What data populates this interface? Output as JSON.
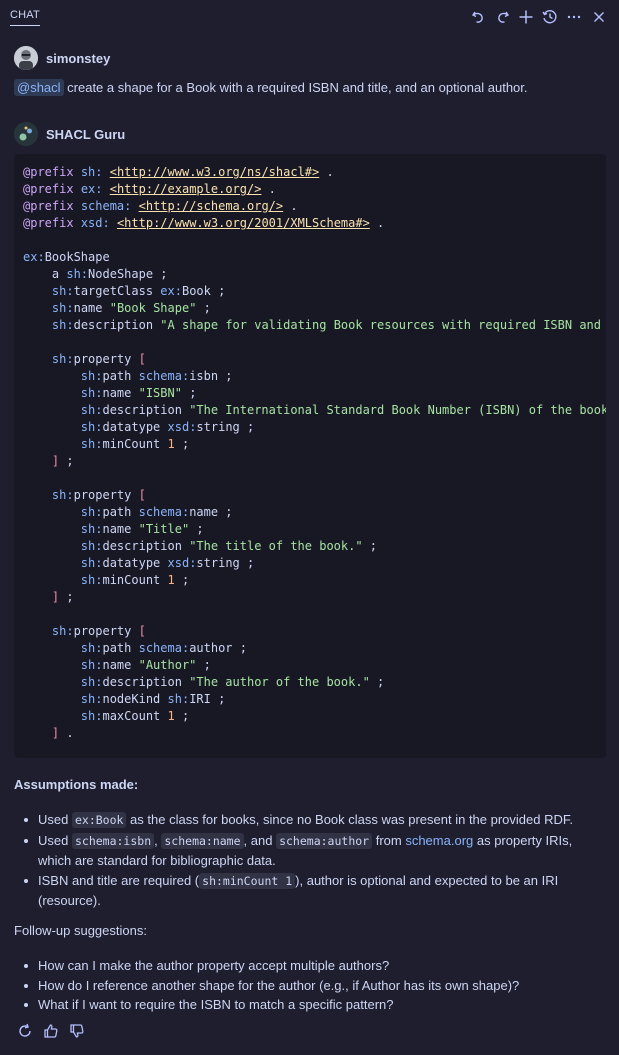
{
  "header": {
    "tab_label": "CHAT"
  },
  "user_message": {
    "username": "simonstey",
    "mention": "@shacl",
    "text": " create a shape for a Book with a required ISBN and title, and an optional author."
  },
  "bot_message": {
    "name": "SHACL Guru",
    "code_lines": [
      [
        [
          "kw",
          "@prefix"
        ],
        [
          "t",
          " "
        ],
        [
          "pfx",
          "sh:"
        ],
        [
          "t",
          " "
        ],
        [
          "iri",
          "<http://www.w3.org/ns/shacl#>"
        ],
        [
          "t",
          " ."
        ]
      ],
      [
        [
          "kw",
          "@prefix"
        ],
        [
          "t",
          " "
        ],
        [
          "pfx",
          "ex:"
        ],
        [
          "t",
          " "
        ],
        [
          "iri",
          "<http://example.org/>"
        ],
        [
          "t",
          " ."
        ]
      ],
      [
        [
          "kw",
          "@prefix"
        ],
        [
          "t",
          " "
        ],
        [
          "pfx",
          "schema:"
        ],
        [
          "t",
          " "
        ],
        [
          "iri",
          "<http://schema.org/>"
        ],
        [
          "t",
          " ."
        ]
      ],
      [
        [
          "kw",
          "@prefix"
        ],
        [
          "t",
          " "
        ],
        [
          "pfx",
          "xsd:"
        ],
        [
          "t",
          " "
        ],
        [
          "iri",
          "<http://www.w3.org/2001/XMLSchema#>"
        ],
        [
          "t",
          " ."
        ]
      ],
      [],
      [
        [
          "pfx",
          "ex:"
        ],
        [
          "t",
          "BookShape"
        ]
      ],
      [
        [
          "t",
          "    a "
        ],
        [
          "pfx",
          "sh:"
        ],
        [
          "t",
          "NodeShape ;"
        ]
      ],
      [
        [
          "t",
          "    "
        ],
        [
          "pfx",
          "sh:"
        ],
        [
          "t",
          "targetClass "
        ],
        [
          "pfx",
          "ex:"
        ],
        [
          "t",
          "Book ;"
        ]
      ],
      [
        [
          "t",
          "    "
        ],
        [
          "pfx",
          "sh:"
        ],
        [
          "t",
          "name "
        ],
        [
          "str",
          "\"Book Shape\""
        ],
        [
          "t",
          " ;"
        ]
      ],
      [
        [
          "t",
          "    "
        ],
        [
          "pfx",
          "sh:"
        ],
        [
          "t",
          "description "
        ],
        [
          "str",
          "\"A shape for validating Book resources with required ISBN and title, and an optional author.\""
        ],
        [
          "t",
          " ;"
        ]
      ],
      [],
      [
        [
          "t",
          "    "
        ],
        [
          "pfx",
          "sh:"
        ],
        [
          "t",
          "property "
        ],
        [
          "brk",
          "["
        ]
      ],
      [
        [
          "t",
          "        "
        ],
        [
          "pfx",
          "sh:"
        ],
        [
          "t",
          "path "
        ],
        [
          "pfx",
          "schema:"
        ],
        [
          "t",
          "isbn ;"
        ]
      ],
      [
        [
          "t",
          "        "
        ],
        [
          "pfx",
          "sh:"
        ],
        [
          "t",
          "name "
        ],
        [
          "str",
          "\"ISBN\""
        ],
        [
          "t",
          " ;"
        ]
      ],
      [
        [
          "t",
          "        "
        ],
        [
          "pfx",
          "sh:"
        ],
        [
          "t",
          "description "
        ],
        [
          "str",
          "\"The International Standard Book Number (ISBN) of the book.\""
        ],
        [
          "t",
          " ;"
        ]
      ],
      [
        [
          "t",
          "        "
        ],
        [
          "pfx",
          "sh:"
        ],
        [
          "t",
          "datatype "
        ],
        [
          "pfx",
          "xsd:"
        ],
        [
          "t",
          "string ;"
        ]
      ],
      [
        [
          "t",
          "        "
        ],
        [
          "pfx",
          "sh:"
        ],
        [
          "t",
          "minCount "
        ],
        [
          "num",
          "1"
        ],
        [
          "t",
          " ;"
        ]
      ],
      [
        [
          "t",
          "    "
        ],
        [
          "brk",
          "]"
        ],
        [
          "t",
          " ;"
        ]
      ],
      [],
      [
        [
          "t",
          "    "
        ],
        [
          "pfx",
          "sh:"
        ],
        [
          "t",
          "property "
        ],
        [
          "brk",
          "["
        ]
      ],
      [
        [
          "t",
          "        "
        ],
        [
          "pfx",
          "sh:"
        ],
        [
          "t",
          "path "
        ],
        [
          "pfx",
          "schema:"
        ],
        [
          "t",
          "name ;"
        ]
      ],
      [
        [
          "t",
          "        "
        ],
        [
          "pfx",
          "sh:"
        ],
        [
          "t",
          "name "
        ],
        [
          "str",
          "\"Title\""
        ],
        [
          "t",
          " ;"
        ]
      ],
      [
        [
          "t",
          "        "
        ],
        [
          "pfx",
          "sh:"
        ],
        [
          "t",
          "description "
        ],
        [
          "str",
          "\"The title of the book.\""
        ],
        [
          "t",
          " ;"
        ]
      ],
      [
        [
          "t",
          "        "
        ],
        [
          "pfx",
          "sh:"
        ],
        [
          "t",
          "datatype "
        ],
        [
          "pfx",
          "xsd:"
        ],
        [
          "t",
          "string ;"
        ]
      ],
      [
        [
          "t",
          "        "
        ],
        [
          "pfx",
          "sh:"
        ],
        [
          "t",
          "minCount "
        ],
        [
          "num",
          "1"
        ],
        [
          "t",
          " ;"
        ]
      ],
      [
        [
          "t",
          "    "
        ],
        [
          "brk",
          "]"
        ],
        [
          "t",
          " ;"
        ]
      ],
      [],
      [
        [
          "t",
          "    "
        ],
        [
          "pfx",
          "sh:"
        ],
        [
          "t",
          "property "
        ],
        [
          "brk",
          "["
        ]
      ],
      [
        [
          "t",
          "        "
        ],
        [
          "pfx",
          "sh:"
        ],
        [
          "t",
          "path "
        ],
        [
          "pfx",
          "schema:"
        ],
        [
          "t",
          "author ;"
        ]
      ],
      [
        [
          "t",
          "        "
        ],
        [
          "pfx",
          "sh:"
        ],
        [
          "t",
          "name "
        ],
        [
          "str",
          "\"Author\""
        ],
        [
          "t",
          " ;"
        ]
      ],
      [
        [
          "t",
          "        "
        ],
        [
          "pfx",
          "sh:"
        ],
        [
          "t",
          "description "
        ],
        [
          "str",
          "\"The author of the book.\""
        ],
        [
          "t",
          " ;"
        ]
      ],
      [
        [
          "t",
          "        "
        ],
        [
          "pfx",
          "sh:"
        ],
        [
          "t",
          "nodeKind "
        ],
        [
          "pfx",
          "sh:"
        ],
        [
          "t",
          "IRI ;"
        ]
      ],
      [
        [
          "t",
          "        "
        ],
        [
          "pfx",
          "sh:"
        ],
        [
          "t",
          "maxCount "
        ],
        [
          "num",
          "1"
        ],
        [
          "t",
          " ;"
        ]
      ],
      [
        [
          "t",
          "    "
        ],
        [
          "brk",
          "]"
        ],
        [
          "t",
          " ."
        ]
      ]
    ],
    "assumptions_title": "Assumptions made:",
    "assumptions": [
      [
        [
          "t",
          "Used "
        ],
        [
          "c",
          "ex:Book"
        ],
        [
          "t",
          " as the class for books, since no Book class was present in the provided RDF."
        ]
      ],
      [
        [
          "t",
          "Used "
        ],
        [
          "c",
          "schema:isbn"
        ],
        [
          "t",
          ", "
        ],
        [
          "c",
          "schema:name"
        ],
        [
          "t",
          ", and "
        ],
        [
          "c",
          "schema:author"
        ],
        [
          "t",
          " from "
        ],
        [
          "l",
          "schema.org"
        ],
        [
          "t",
          " as property IRIs, which are standard for bibliographic data."
        ]
      ],
      [
        [
          "t",
          "ISBN and title are required ("
        ],
        [
          "c",
          "sh:minCount 1"
        ],
        [
          "t",
          "), author is optional and expected to be an IRI (resource)."
        ]
      ]
    ],
    "followup_title": "Follow-up suggestions:",
    "followups": [
      "How can I make the author property accept multiple authors?",
      "How do I reference another shape for the author (e.g., if Author has its own shape)?",
      "What if I want to require the ISBN to match a specific pattern?"
    ]
  }
}
